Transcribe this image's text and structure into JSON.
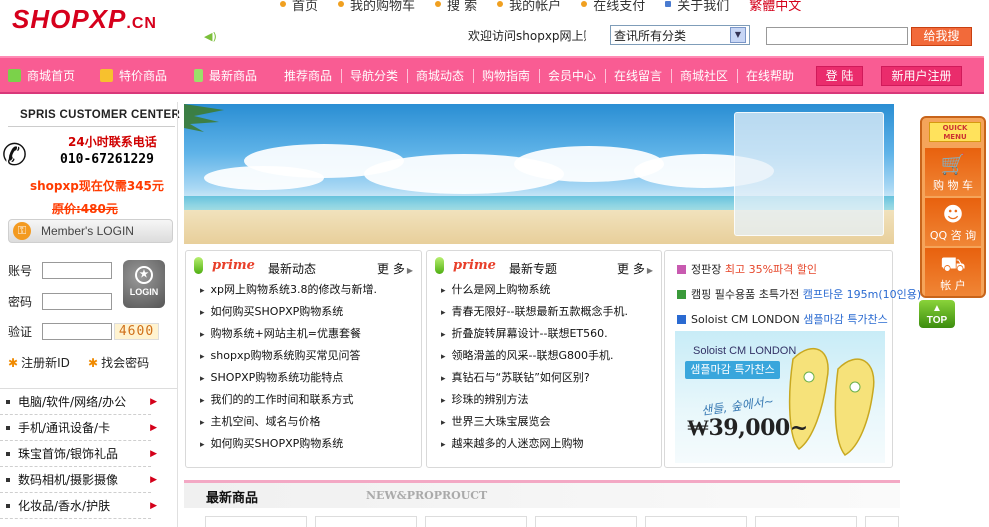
{
  "header": {
    "logo_main": "SHOPXP",
    "logo_suffix": ".CN",
    "top_links": [
      {
        "label": "首页"
      },
      {
        "label": "我的购物车"
      },
      {
        "label": "搜  索"
      },
      {
        "label": "我的帐户"
      },
      {
        "label": "在线支付"
      },
      {
        "label": "关于我们"
      }
    ],
    "language_link": "繁體中文",
    "welcome_text": "欢迎访问shopxp网上购物系统",
    "category_select": {
      "selected": "查讯所有分类"
    },
    "search_input": {
      "value": ""
    },
    "search_button": "给我搜"
  },
  "navbar": {
    "items": [
      {
        "label": "商城首页",
        "icon": "edit-icon",
        "color": "#7bd24a"
      },
      {
        "label": "特价商品",
        "icon": "gift-icon",
        "color": "#f7c12e"
      },
      {
        "label": "最新商品",
        "icon": "phone-icon",
        "color": "#9be06a"
      },
      {
        "label": "推荐商品"
      },
      {
        "label": "导航分类"
      },
      {
        "label": "商城动态"
      },
      {
        "label": "购物指南"
      },
      {
        "label": "会员中心"
      },
      {
        "label": "在线留言"
      },
      {
        "label": "商城社区"
      },
      {
        "label": "在线帮助"
      }
    ],
    "login_button": "登 陆",
    "register_button": "新用户注册"
  },
  "customer_center": {
    "title": "SPRIS CUSTOMER CENTER",
    "hotline_label": "24小时联系电话",
    "hotline": "010-67261229",
    "price_now": "shopxp现在仅需345元",
    "price_old": "原价:480元"
  },
  "login": {
    "bar_label": "Member's LOGIN",
    "username_label": "账号",
    "password_label": "密码",
    "captcha_label": "验证",
    "captcha_code": "4600",
    "login_button": "LOGIN",
    "register_link": "注册新ID",
    "forgot_link": "找会密码"
  },
  "categories": [
    {
      "label": "电脑/软件/网络/办公"
    },
    {
      "label": "手机/通讯设备/卡"
    },
    {
      "label": "珠宝首饰/银饰礼品"
    },
    {
      "label": "数码相机/摄影摄像"
    },
    {
      "label": "化妆品/香水/护肤"
    }
  ],
  "news_box": {
    "prime": "prime",
    "title": "最新动态",
    "more": "更 多",
    "items": [
      "xp网上购物系统3.8的修改与新增.",
      "如何购买SHOPXP购物系统",
      "购物系统+网站主机=优惠套餐",
      "shopxp购物系统购买常见问答",
      "SHOPXP购物系统功能特点",
      "我们的的工作时间和联系方式",
      "主机空间、域名与价格",
      "如何购买SHOPXP购物系统"
    ]
  },
  "topic_box": {
    "prime": "prime",
    "title": "最新专题",
    "more": "更 多",
    "items": [
      "什么是网上购物系统",
      "青春无限好--联想最新五款概念手机.",
      "折叠旋转屏幕设计--联想ET560.",
      "领略滑盖的风采--联想G800手机.",
      "真钻石与“苏联钻”如何区别?",
      "珍珠的辨别方法",
      "世界三大珠宝展览会",
      "越来越多的人迷恋网上购物"
    ]
  },
  "ad_box": {
    "line1_a": "정판장 ",
    "line1_b": "최고 35%파격 할인",
    "line2_a": "캠핑 필수용품 초특가전 ",
    "line2_b": "캠프타운 195m(10인용)",
    "line3_a": "Soloist CM LONDON ",
    "line3_b": "샘플마감 특가찬스",
    "image_title": "Soloist CM LONDON",
    "image_badge": "샘플마감 특가찬스",
    "image_script": "샌들, 숲에서~",
    "image_price": "₩39,000~"
  },
  "quick_menu": {
    "header_line1": "QUICK",
    "header_line2": "MENU",
    "cart": "购 物 车",
    "qq": "QQ 咨 询",
    "account": "帐 户",
    "top": "TOP"
  },
  "new_products": {
    "title": "最新商品",
    "subtitle": "NEW&PROPROUCT"
  }
}
